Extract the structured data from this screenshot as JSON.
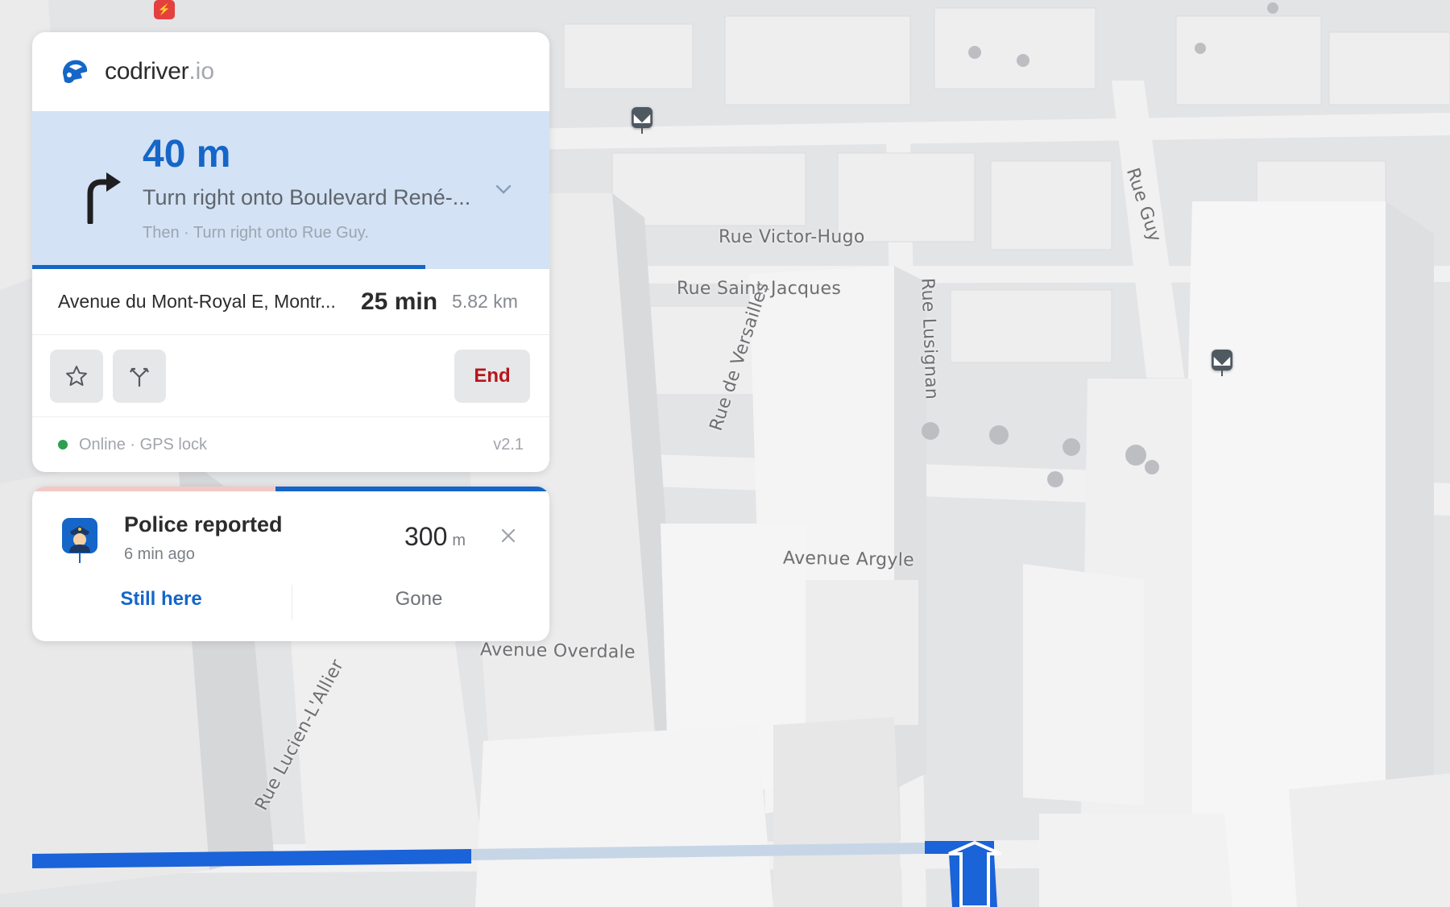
{
  "brand": {
    "name": "codriver",
    "tld": ".io",
    "logo_icon": "helmet-icon",
    "accent_color": "#1566c8"
  },
  "instruction": {
    "distance": "40 m",
    "street": "Turn right onto Boulevard René-...",
    "then": "Then · Turn right onto Rue Guy.",
    "turn_icon": "turn-right-arrow-icon",
    "expand_icon": "chevron-down-icon",
    "progress_fraction": 0.76
  },
  "route": {
    "destination": "Avenue du Mont-Royal E, Montr...",
    "eta": "25 min",
    "distance": "5.82 km"
  },
  "actions": {
    "favorite_icon": "star-icon",
    "alternate_route_icon": "route-fork-icon",
    "end_label": "End",
    "end_color": "#b6161b"
  },
  "status": {
    "text": "Online · GPS lock",
    "version": "v2.1",
    "dot_color": "#2e9e51"
  },
  "alert": {
    "title": "Police reported",
    "time": "6 min ago",
    "distance_value": "300",
    "distance_unit": "m",
    "still_here_label": "Still here",
    "gone_label": "Gone",
    "icon": "police-officer-icon",
    "timer_fraction": 0.53
  },
  "map": {
    "streets": {
      "victor_hugo": "Rue Victor-Hugo",
      "saint_jacques": "Rue Saint-Jacques",
      "versailles": "Rue de Versailles",
      "lusignan": "Rue Lusignan",
      "guy": "Rue Guy",
      "argyle": "Avenue Argyle",
      "overdale": "Avenue Overdale",
      "lallier": "Rue Lucien-L'Allier"
    },
    "route_color": "#1a63d8",
    "markers": [
      "traffic-camera-icon",
      "traffic-camera-icon",
      "ev-charging-icon"
    ]
  }
}
